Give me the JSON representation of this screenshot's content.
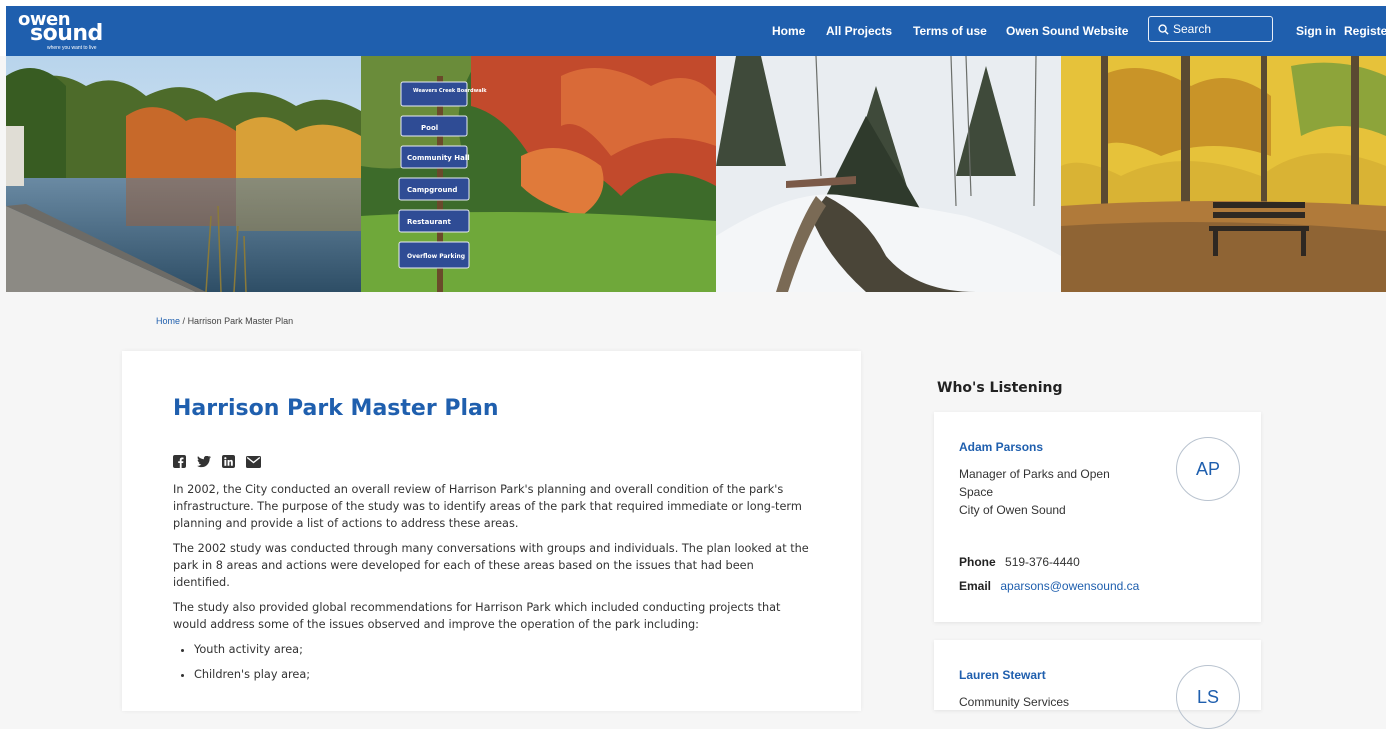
{
  "header": {
    "logo_line1": "owen",
    "logo_line2": "sound",
    "logo_tagline": "where you want to live",
    "nav": [
      "Home",
      "All Projects",
      "Terms of use",
      "Owen Sound Website"
    ],
    "search_placeholder": "Search",
    "sign_in": "Sign in",
    "register": "Register"
  },
  "banner": {
    "sign_labels": [
      "Weavers Creek Boardwalk",
      "Pool",
      "Community Hall",
      "Campground",
      "Restaurant",
      "Overflow Parking"
    ]
  },
  "breadcrumb": {
    "home": "Home",
    "separator": "/",
    "current": "Harrison Park Master Plan"
  },
  "main": {
    "title": "Harrison Park Master Plan",
    "share_icons": [
      "facebook-icon",
      "twitter-icon",
      "linkedin-icon",
      "email-icon"
    ],
    "paragraphs": [
      "In 2002, the City conducted an overall review of Harrison Park's planning and overall condition of the park's infrastructure. The purpose of the study was to identify areas of the park that required immediate or long-term planning and provide a list of actions to address these areas.",
      "The 2002 study was conducted through many conversations with groups and individuals. The plan looked at the park in 8 areas and actions were developed for each of these areas based on the issues that had been identified.",
      "The study also provided global recommendations for Harrison Park which included conducting projects that would address some of the issues observed and improve the operation of the park including:"
    ],
    "list": [
      "Youth activity area;",
      "Children's play area;"
    ]
  },
  "listening": {
    "title": "Who's Listening",
    "people": [
      {
        "name": "Adam Parsons",
        "role": "Manager of Parks and Open Space",
        "org": "City of Owen Sound",
        "initials": "AP",
        "phone_label": "Phone",
        "phone": "519-376-4440",
        "email_label": "Email",
        "email": "aparsons@owensound.ca"
      },
      {
        "name": "Lauren Stewart",
        "role": "Community Services",
        "initials": "LS"
      }
    ]
  },
  "colors": {
    "brand": "#1f5fae",
    "page_bg": "#f6f6f6"
  }
}
